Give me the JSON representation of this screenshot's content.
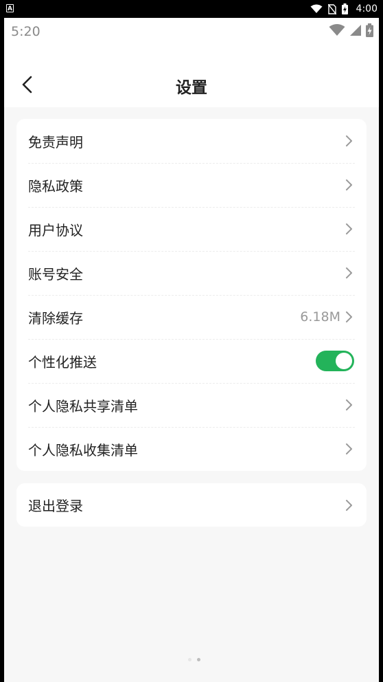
{
  "system_bar": {
    "left_icon_letter": "A",
    "time": "4:00",
    "icons": [
      "wifi-icon",
      "no-sim-icon",
      "battery-charging-icon"
    ]
  },
  "app_status": {
    "time": "5:20",
    "icons": [
      "wifi-icon",
      "signal-icon",
      "battery-charging-icon"
    ]
  },
  "header": {
    "back_icon": "chevron-left-icon",
    "title": "设置"
  },
  "settings": {
    "items": [
      {
        "label": "免责声明"
      },
      {
        "label": "隐私政策"
      },
      {
        "label": "用户协议"
      },
      {
        "label": "账号安全"
      },
      {
        "label": "清除缓存",
        "value": "6.18M"
      },
      {
        "label": "个性化推送",
        "toggle_on": true
      },
      {
        "label": "个人隐私共享清单"
      },
      {
        "label": "个人隐私收集清单"
      }
    ]
  },
  "logout": {
    "label": "退出登录"
  },
  "colors": {
    "accent_toggle": "#23b35a",
    "background": "#f7f7f7",
    "card": "#ffffff"
  }
}
